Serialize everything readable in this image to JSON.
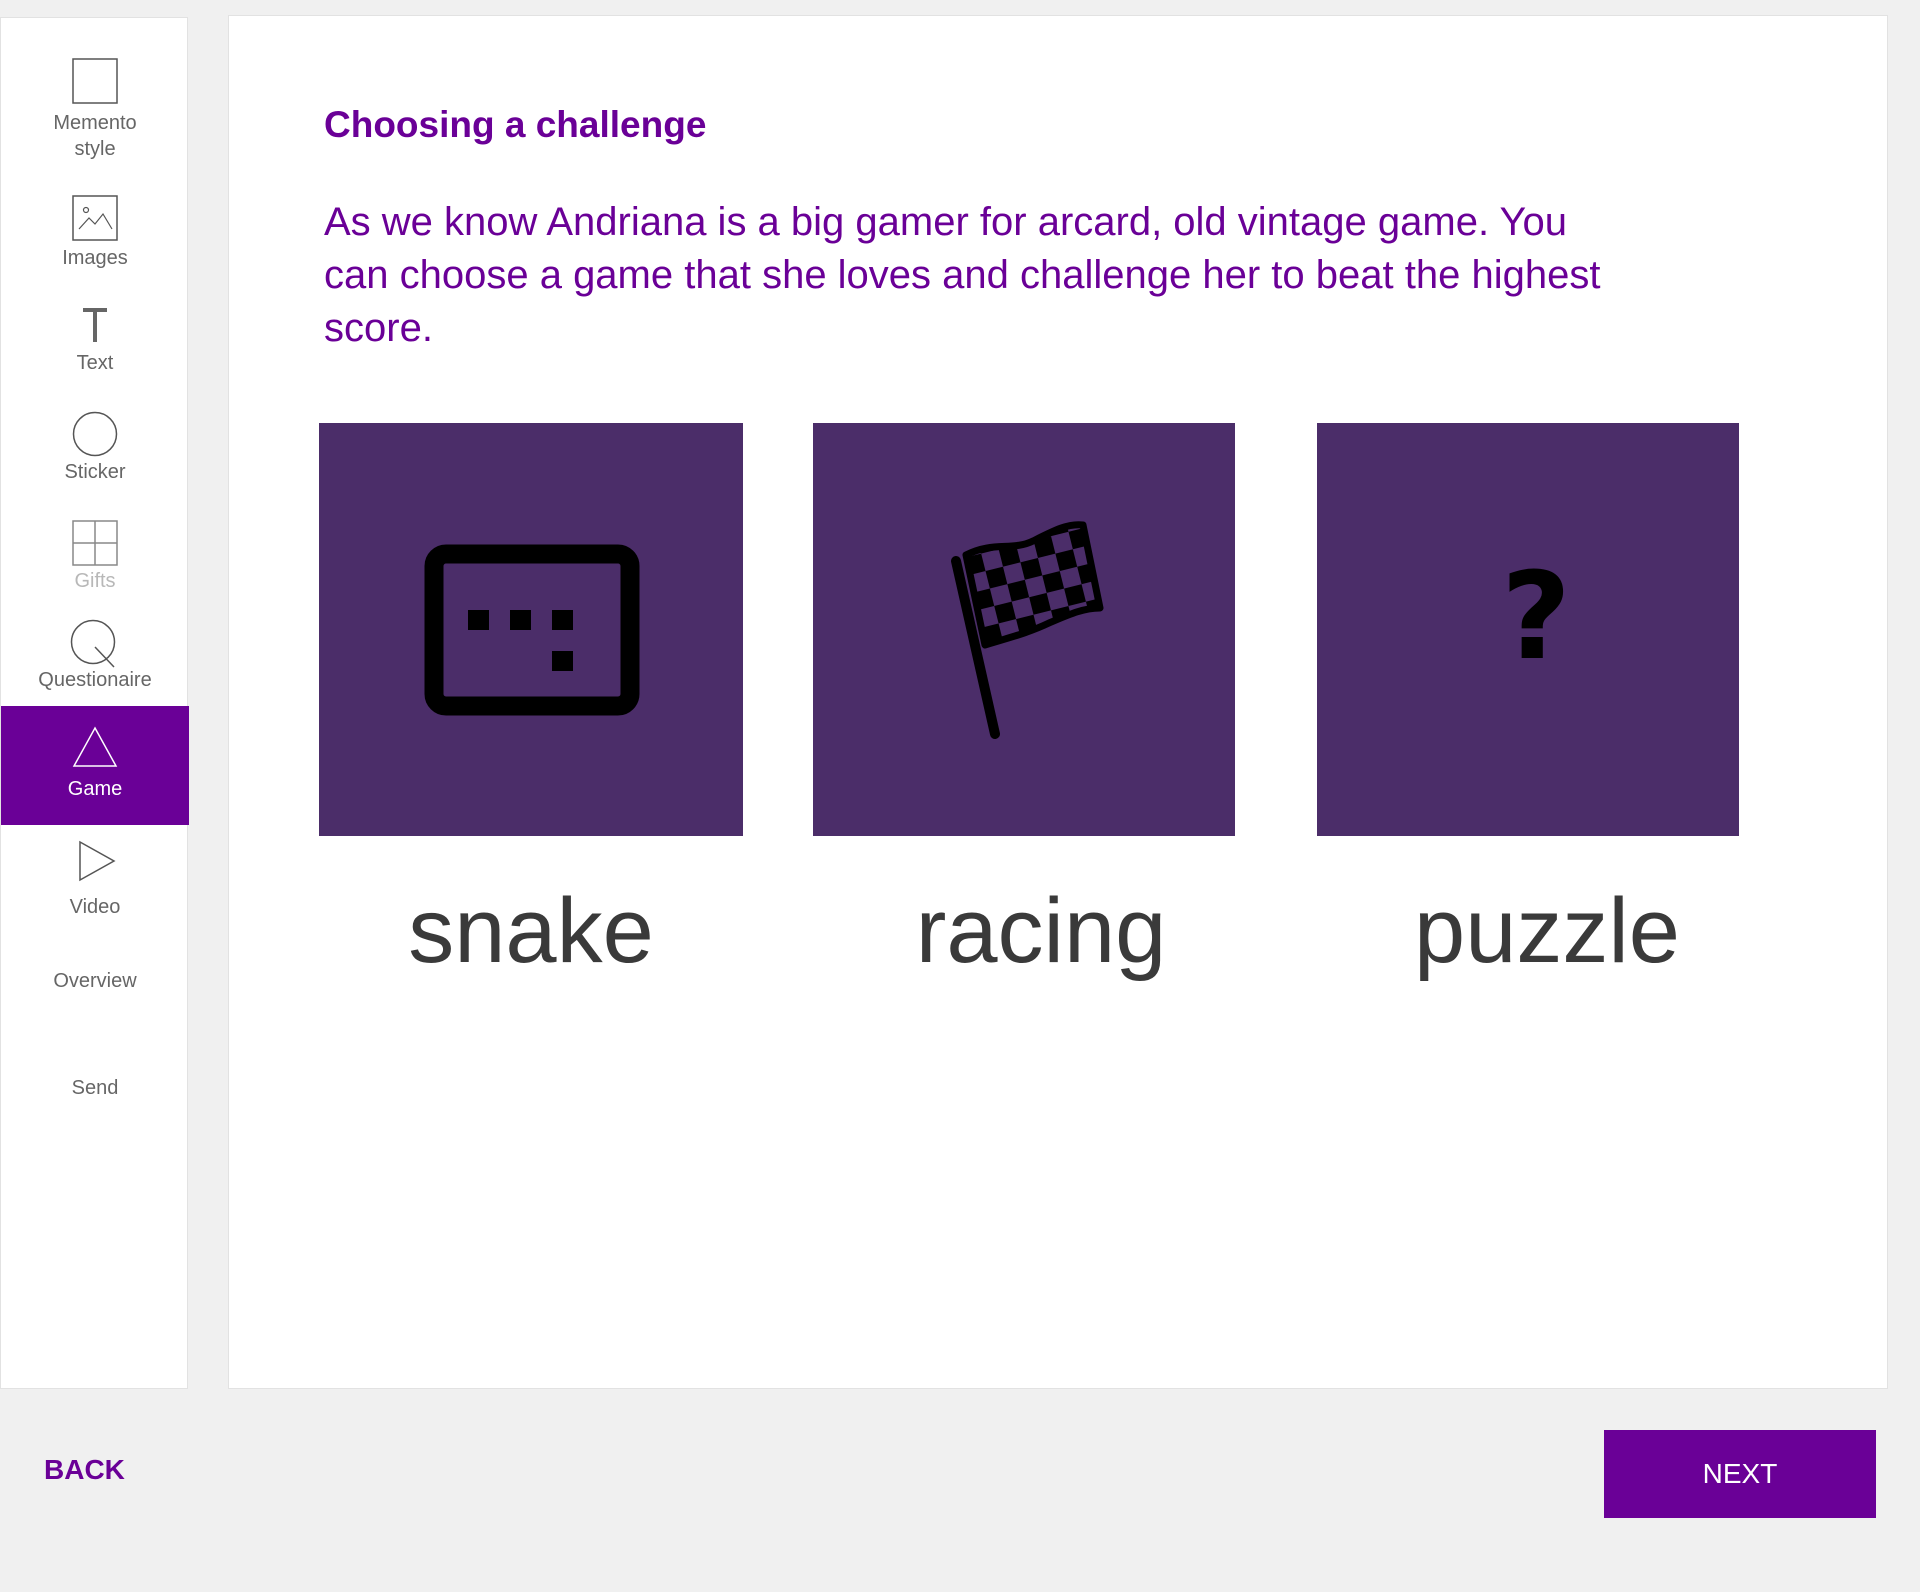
{
  "sidebar": {
    "items": [
      {
        "label": "Memento style",
        "icon": "square-icon"
      },
      {
        "label": "Images",
        "icon": "image-icon"
      },
      {
        "label": "Text",
        "icon": "text-icon"
      },
      {
        "label": "Sticker",
        "icon": "circle-icon"
      },
      {
        "label": "Gifts",
        "icon": "grid-icon"
      },
      {
        "label": "Questionaire",
        "icon": "magnifier-icon"
      },
      {
        "label": "Game",
        "icon": "triangle-icon",
        "active": true
      },
      {
        "label": "Video",
        "icon": "play-icon"
      },
      {
        "label": "Overview"
      },
      {
        "label": "Send"
      }
    ]
  },
  "main": {
    "title": "Choosing a challenge",
    "intro": "As we know Andriana is a big gamer for arcard, old vintage game. You can choose a game that she loves and challenge her to beat the highest score.",
    "games": [
      {
        "label": "snake",
        "icon": "keyboard-icon"
      },
      {
        "label": "racing",
        "icon": "checkered-flag-icon"
      },
      {
        "label": "puzzle",
        "icon": "question-mark-icon"
      }
    ]
  },
  "footer": {
    "back_label": "BACK",
    "next_label": "NEXT"
  },
  "colors": {
    "accent": "#6a0097",
    "card": "#4b2d69",
    "background": "#f0f0f0"
  }
}
